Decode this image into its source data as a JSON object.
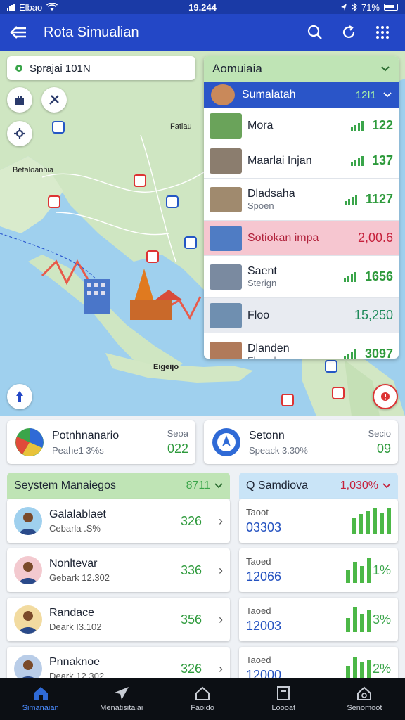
{
  "status_bar": {
    "carrier": "Elbao",
    "time": "19.244",
    "battery": "71%"
  },
  "app_bar": {
    "title": "Rota Simualian"
  },
  "map": {
    "search_text": "Sprajai 101N",
    "labels": [
      "Fatiau",
      "Betaloanhia",
      "Eigeijo"
    ]
  },
  "panel": {
    "header": "Aomuiaia",
    "selected": {
      "name": "Sumalatah",
      "value": "12I1"
    },
    "rows": [
      {
        "name": "Mora",
        "sub": "",
        "value": "122",
        "style": "plain"
      },
      {
        "name": "Maarlai Injan",
        "sub": "",
        "value": "137",
        "style": "plain"
      },
      {
        "name": "Dladsaha",
        "sub": "Spoen",
        "value": "1127",
        "style": "tall"
      },
      {
        "name": "Sotiokan impa",
        "sub": "",
        "value": "2,00.6",
        "style": "pink"
      },
      {
        "name": "Saent",
        "sub": "Sterign",
        "value": "1656",
        "style": "tall"
      },
      {
        "name": "Floo",
        "sub": "",
        "value": "15,250",
        "style": "grey"
      },
      {
        "name": "Dlanden",
        "sub": "Eloanda",
        "value": "3097",
        "style": "tall"
      }
    ]
  },
  "stats": [
    {
      "name": "Potnhnanario",
      "sub": "Peahe1 3%s",
      "side": "Seoa",
      "value": "022"
    },
    {
      "name": "Setonn",
      "sub": "Speack 3.30%",
      "side": "Secio",
      "value": "09"
    }
  ],
  "systems": {
    "header": "Seystem Manaiegos",
    "header_value": "8711",
    "items": [
      {
        "name": "Galalablaet",
        "sub": "Cebarla .S%",
        "value": "326"
      },
      {
        "name": "Nonltevar",
        "sub": "Gebark 12.302",
        "value": "336"
      },
      {
        "name": "Randace",
        "sub": "Deark I3.102",
        "value": "356"
      },
      {
        "name": "Pnnaknoe",
        "sub": "Deark 12.302",
        "value": "326"
      }
    ]
  },
  "trends": {
    "header": "Q Samdiova",
    "header_value": "1,030%",
    "items": [
      {
        "label": "Taoot",
        "value": "03303",
        "pct": ""
      },
      {
        "label": "Taoed",
        "value": "12066",
        "pct": "1%"
      },
      {
        "label": "Taoed",
        "value": "12003",
        "pct": "3%"
      },
      {
        "label": "Taoed",
        "value": "12000",
        "pct": "2%"
      }
    ]
  },
  "nav": [
    {
      "label": "Simanaian",
      "icon": "home-icon"
    },
    {
      "label": "Menatisitaiai",
      "icon": "send-icon"
    },
    {
      "label": "Faoido",
      "icon": "house-outline-icon"
    },
    {
      "label": "Loooat",
      "icon": "document-icon"
    },
    {
      "label": "Senomoot",
      "icon": "settings-house-icon"
    }
  ],
  "colors": {
    "app_bar": "#2347c6",
    "status_bar": "#1a3aa6",
    "green_header": "#bfe4b5",
    "blue_header": "#c9e4f7",
    "accent_green": "#2e9a3c",
    "accent_blue": "#2452c0",
    "alert_red": "#c6213c"
  }
}
